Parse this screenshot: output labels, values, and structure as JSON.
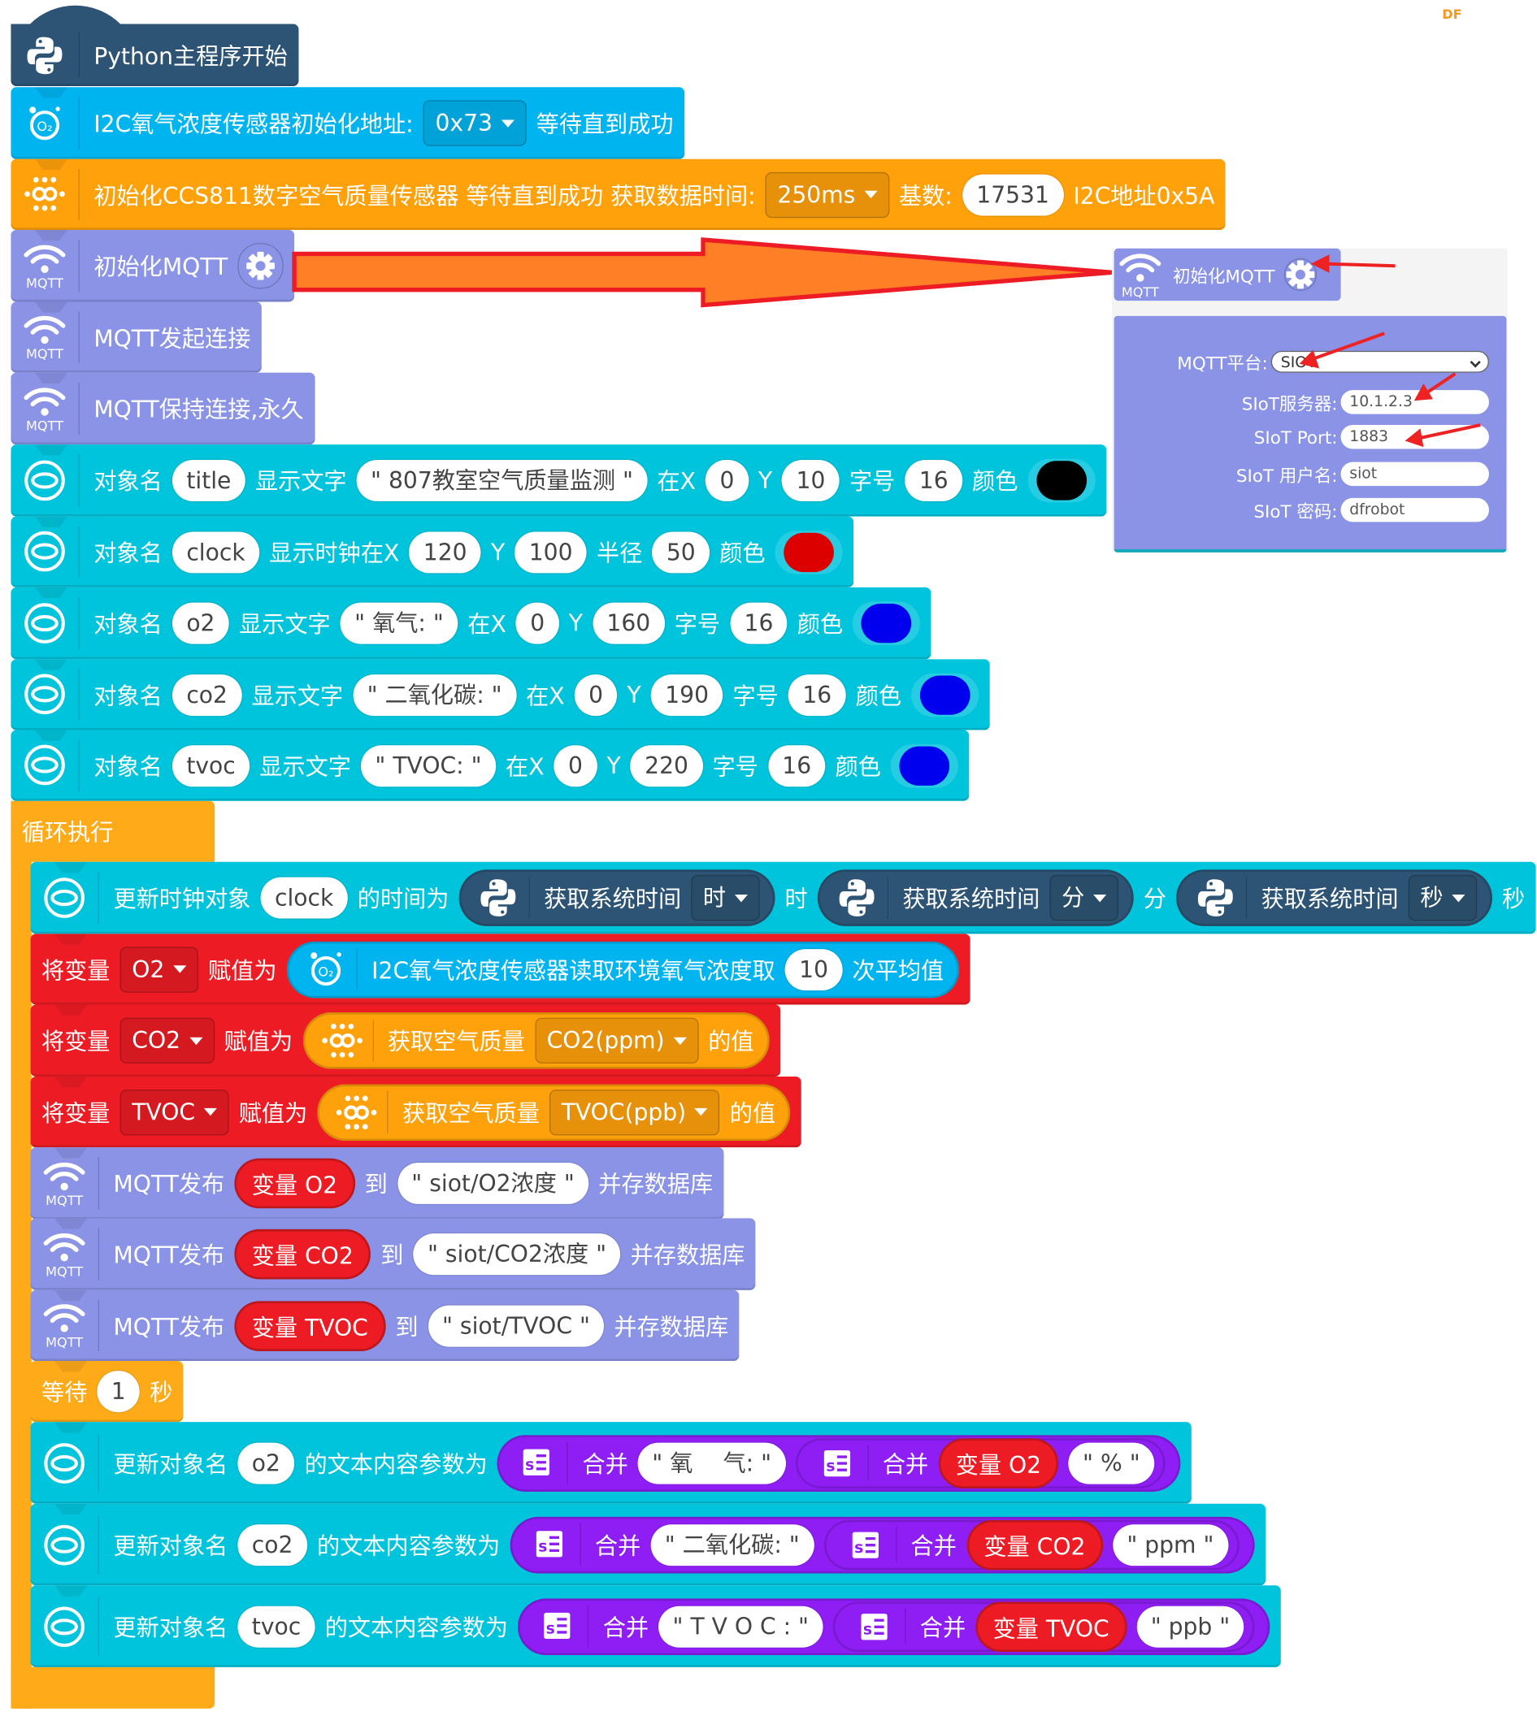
{
  "watermark": "DF",
  "colors": {
    "python": "#2d5474",
    "o2": "#00b4f0",
    "ccs": "#ffa10a",
    "mqtt": "#8a93e6",
    "display": "#00c4dc",
    "variable": "#ed1c24",
    "loop": "#ffab19",
    "merge": "#8f1ef5",
    "annotation_arrow": "#ff7f27",
    "annotation_outline": "#ed1c24"
  },
  "blocks": [
    {
      "icon": "python-icon",
      "color": "python",
      "segments": [
        {
          "t": "text",
          "v": "Python主程序开始"
        }
      ]
    },
    {
      "icon": "oxygen-sensor-icon",
      "color": "o2",
      "segments": [
        {
          "t": "text",
          "v": "I2C氧气浓度传感器初始化地址:"
        },
        {
          "t": "dd",
          "v": "0x73"
        },
        {
          "t": "text",
          "v": "等待直到成功"
        }
      ]
    },
    {
      "icon": "air-quality-sensor-icon",
      "color": "ccs",
      "segments": [
        {
          "t": "text",
          "v": "初始化CCS811数字空气质量传感器 等待直到成功 获取数据时间:"
        },
        {
          "t": "dd",
          "v": "250ms"
        },
        {
          "t": "text",
          "v": "基数:"
        },
        {
          "t": "input",
          "v": "17531"
        },
        {
          "t": "text",
          "v": "I2C地址0x5A"
        }
      ]
    },
    {
      "icon": "mqtt-icon",
      "color": "mqtt",
      "segments": [
        {
          "t": "text",
          "v": "初始化MQTT"
        },
        {
          "t": "gear"
        }
      ]
    },
    {
      "icon": "mqtt-icon",
      "color": "mqtt",
      "segments": [
        {
          "t": "text",
          "v": "MQTT发起连接"
        }
      ]
    },
    {
      "icon": "mqtt-icon",
      "color": "mqtt",
      "segments": [
        {
          "t": "text",
          "v": "MQTT保持连接,永久"
        }
      ]
    },
    {
      "icon": "display-object-icon",
      "color": "display",
      "segments": [
        {
          "t": "text",
          "v": "对象名"
        },
        {
          "t": "input",
          "v": "title"
        },
        {
          "t": "text",
          "v": "显示文字"
        },
        {
          "t": "string",
          "v": "807教室空气质量监测"
        },
        {
          "t": "text",
          "v": "在X"
        },
        {
          "t": "input",
          "v": "0"
        },
        {
          "t": "text",
          "v": "Y"
        },
        {
          "t": "input",
          "v": "10"
        },
        {
          "t": "text",
          "v": "字号"
        },
        {
          "t": "input",
          "v": "16"
        },
        {
          "t": "text",
          "v": "颜色"
        },
        {
          "t": "swatch",
          "color": "#000000"
        }
      ]
    },
    {
      "icon": "display-object-icon",
      "color": "display",
      "segments": [
        {
          "t": "text",
          "v": "对象名"
        },
        {
          "t": "input",
          "v": "clock"
        },
        {
          "t": "text",
          "v": "显示时钟在X"
        },
        {
          "t": "input",
          "v": "120"
        },
        {
          "t": "text",
          "v": "Y"
        },
        {
          "t": "input",
          "v": "100"
        },
        {
          "t": "text",
          "v": "半径"
        },
        {
          "t": "input",
          "v": "50"
        },
        {
          "t": "text",
          "v": "颜色"
        },
        {
          "t": "swatch",
          "color": "#dd0000"
        }
      ]
    },
    {
      "icon": "display-object-icon",
      "color": "display",
      "segments": [
        {
          "t": "text",
          "v": "对象名"
        },
        {
          "t": "input",
          "v": "o2"
        },
        {
          "t": "text",
          "v": "显示文字"
        },
        {
          "t": "string",
          "v": "氧气:"
        },
        {
          "t": "text",
          "v": "在X"
        },
        {
          "t": "input",
          "v": "0"
        },
        {
          "t": "text",
          "v": "Y"
        },
        {
          "t": "input",
          "v": "160"
        },
        {
          "t": "text",
          "v": "字号"
        },
        {
          "t": "input",
          "v": "16"
        },
        {
          "t": "text",
          "v": "颜色"
        },
        {
          "t": "swatch",
          "color": "#0000ee"
        }
      ]
    },
    {
      "icon": "display-object-icon",
      "color": "display",
      "segments": [
        {
          "t": "text",
          "v": "对象名"
        },
        {
          "t": "input",
          "v": "co2"
        },
        {
          "t": "text",
          "v": "显示文字"
        },
        {
          "t": "string",
          "v": "二氧化碳:"
        },
        {
          "t": "text",
          "v": "在X"
        },
        {
          "t": "input",
          "v": "0"
        },
        {
          "t": "text",
          "v": "Y"
        },
        {
          "t": "input",
          "v": "190"
        },
        {
          "t": "text",
          "v": "字号"
        },
        {
          "t": "input",
          "v": "16"
        },
        {
          "t": "text",
          "v": "颜色"
        },
        {
          "t": "swatch",
          "color": "#0000ee"
        }
      ]
    },
    {
      "icon": "display-object-icon",
      "color": "display",
      "segments": [
        {
          "t": "text",
          "v": "对象名"
        },
        {
          "t": "input",
          "v": "tvoc"
        },
        {
          "t": "text",
          "v": "显示文字"
        },
        {
          "t": "string",
          "v": "TVOC:"
        },
        {
          "t": "text",
          "v": "在X"
        },
        {
          "t": "input",
          "v": "0"
        },
        {
          "t": "text",
          "v": "Y"
        },
        {
          "t": "input",
          "v": "220"
        },
        {
          "t": "text",
          "v": "字号"
        },
        {
          "t": "input",
          "v": "16"
        },
        {
          "t": "text",
          "v": "颜色"
        },
        {
          "t": "swatch",
          "color": "#0000ee"
        }
      ]
    }
  ],
  "loop": {
    "label": "循环执行",
    "blocks": [
      {
        "icon": "display-object-icon",
        "color": "display",
        "segments": [
          {
            "t": "text",
            "v": "更新时钟对象"
          },
          {
            "t": "input",
            "v": "clock"
          },
          {
            "t": "text",
            "v": "的时间为"
          },
          {
            "t": "rep",
            "color": "python",
            "icon": "python-icon",
            "segments": [
              {
                "t": "text",
                "v": "获取系统时间"
              },
              {
                "t": "dd",
                "v": "时"
              }
            ]
          },
          {
            "t": "text",
            "v": "时"
          },
          {
            "t": "rep",
            "color": "python",
            "icon": "python-icon",
            "segments": [
              {
                "t": "text",
                "v": "获取系统时间"
              },
              {
                "t": "dd",
                "v": "分"
              }
            ]
          },
          {
            "t": "text",
            "v": "分"
          },
          {
            "t": "rep",
            "color": "python",
            "icon": "python-icon",
            "segments": [
              {
                "t": "text",
                "v": "获取系统时间"
              },
              {
                "t": "dd",
                "v": "秒"
              }
            ]
          },
          {
            "t": "text",
            "v": "秒"
          }
        ]
      },
      {
        "color": "variable",
        "segments": [
          {
            "t": "text",
            "v": "将变量"
          },
          {
            "t": "dd",
            "v": "O2"
          },
          {
            "t": "text",
            "v": "赋值为"
          },
          {
            "t": "rep",
            "color": "o2",
            "icon": "oxygen-sensor-icon",
            "segments": [
              {
                "t": "text",
                "v": "I2C氧气浓度传感器读取环境氧气浓度取"
              },
              {
                "t": "input",
                "v": "10"
              },
              {
                "t": "text",
                "v": "次平均值"
              }
            ]
          }
        ]
      },
      {
        "color": "variable",
        "segments": [
          {
            "t": "text",
            "v": "将变量"
          },
          {
            "t": "dd",
            "v": "CO2"
          },
          {
            "t": "text",
            "v": "赋值为"
          },
          {
            "t": "rep",
            "color": "ccs",
            "icon": "air-quality-sensor-icon",
            "segments": [
              {
                "t": "text",
                "v": "获取空气质量"
              },
              {
                "t": "dd",
                "v": "CO2(ppm)"
              },
              {
                "t": "text",
                "v": "的值"
              }
            ]
          }
        ]
      },
      {
        "color": "variable",
        "segments": [
          {
            "t": "text",
            "v": "将变量"
          },
          {
            "t": "dd",
            "v": "TVOC"
          },
          {
            "t": "text",
            "v": "赋值为"
          },
          {
            "t": "rep",
            "color": "ccs",
            "icon": "air-quality-sensor-icon",
            "segments": [
              {
                "t": "text",
                "v": "获取空气质量"
              },
              {
                "t": "dd",
                "v": "TVOC(ppb)"
              },
              {
                "t": "text",
                "v": "的值"
              }
            ]
          }
        ]
      },
      {
        "icon": "mqtt-icon",
        "color": "mqtt",
        "segments": [
          {
            "t": "text",
            "v": "MQTT发布"
          },
          {
            "t": "var",
            "v": "变量 O2"
          },
          {
            "t": "text",
            "v": "到"
          },
          {
            "t": "string",
            "v": "siot/O2浓度"
          },
          {
            "t": "text",
            "v": "并存数据库"
          }
        ]
      },
      {
        "icon": "mqtt-icon",
        "color": "mqtt",
        "segments": [
          {
            "t": "text",
            "v": "MQTT发布"
          },
          {
            "t": "var",
            "v": "变量 CO2"
          },
          {
            "t": "text",
            "v": "到"
          },
          {
            "t": "string",
            "v": "siot/CO2浓度"
          },
          {
            "t": "text",
            "v": "并存数据库"
          }
        ]
      },
      {
        "icon": "mqtt-icon",
        "color": "mqtt",
        "segments": [
          {
            "t": "text",
            "v": "MQTT发布"
          },
          {
            "t": "var",
            "v": "变量 TVOC"
          },
          {
            "t": "text",
            "v": "到"
          },
          {
            "t": "string",
            "v": "siot/TVOC"
          },
          {
            "t": "text",
            "v": "并存数据库"
          }
        ]
      },
      {
        "color": "loop",
        "segments": [
          {
            "t": "text",
            "v": "等待"
          },
          {
            "t": "input",
            "v": "1"
          },
          {
            "t": "text",
            "v": "秒"
          }
        ]
      },
      {
        "icon": "display-object-icon",
        "color": "display",
        "segments": [
          {
            "t": "text",
            "v": "更新对象名"
          },
          {
            "t": "input",
            "v": "o2"
          },
          {
            "t": "text",
            "v": "的文本内容参数为"
          },
          {
            "t": "rep",
            "color": "merge",
            "icon": "merge-text-icon",
            "segments": [
              {
                "t": "text",
                "v": "合并"
              },
              {
                "t": "string",
                "v": "氧　 气:"
              },
              {
                "t": "rep",
                "color": "merge",
                "icon": "merge-text-icon",
                "segments": [
                  {
                    "t": "text",
                    "v": "合并"
                  },
                  {
                    "t": "var",
                    "v": "变量 O2"
                  },
                  {
                    "t": "string",
                    "v": "%"
                  }
                ]
              }
            ]
          }
        ]
      },
      {
        "icon": "display-object-icon",
        "color": "display",
        "segments": [
          {
            "t": "text",
            "v": "更新对象名"
          },
          {
            "t": "input",
            "v": "co2"
          },
          {
            "t": "text",
            "v": "的文本内容参数为"
          },
          {
            "t": "rep",
            "color": "merge",
            "icon": "merge-text-icon",
            "segments": [
              {
                "t": "text",
                "v": "合并"
              },
              {
                "t": "string",
                "v": "二氧化碳:"
              },
              {
                "t": "rep",
                "color": "merge",
                "icon": "merge-text-icon",
                "segments": [
                  {
                    "t": "text",
                    "v": "合并"
                  },
                  {
                    "t": "var",
                    "v": "变量 CO2"
                  },
                  {
                    "t": "string",
                    "v": "ppm"
                  }
                ]
              }
            ]
          }
        ]
      },
      {
        "icon": "display-object-icon",
        "color": "display",
        "segments": [
          {
            "t": "text",
            "v": "更新对象名"
          },
          {
            "t": "input",
            "v": "tvoc"
          },
          {
            "t": "text",
            "v": "的文本内容参数为"
          },
          {
            "t": "rep",
            "color": "merge",
            "icon": "merge-text-icon",
            "segments": [
              {
                "t": "text",
                "v": "合并"
              },
              {
                "t": "string",
                "v": "T V O C :"
              },
              {
                "t": "rep",
                "color": "merge",
                "icon": "merge-text-icon",
                "segments": [
                  {
                    "t": "text",
                    "v": "合并"
                  },
                  {
                    "t": "var",
                    "v": "变量 TVOC"
                  },
                  {
                    "t": "string",
                    "v": "ppb"
                  }
                ]
              }
            ]
          }
        ]
      }
    ]
  },
  "inset": {
    "block_label": "初始化MQTT",
    "fields": [
      {
        "label": "MQTT平台:",
        "value": "SIOT",
        "kind": "select"
      },
      {
        "label": "SIoT服务器:",
        "value": "10.1.2.3",
        "kind": "input"
      },
      {
        "label": "SIoT Port:",
        "value": "1883",
        "kind": "input"
      },
      {
        "label": "SIoT 用户名:",
        "value": "siot",
        "kind": "input"
      },
      {
        "label": "SIoT 密码:",
        "value": "dfrobot",
        "kind": "input"
      }
    ]
  }
}
